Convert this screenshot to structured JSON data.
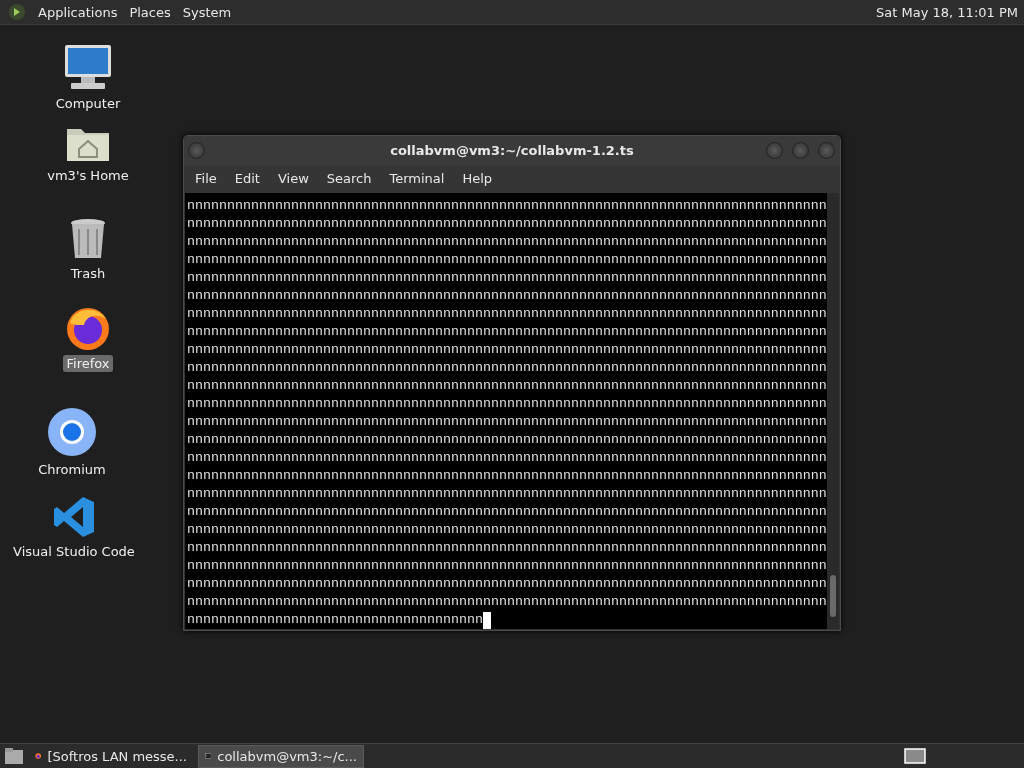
{
  "top_panel": {
    "menus": [
      "Applications",
      "Places",
      "System"
    ],
    "clock": "Sat May 18, 11:01 PM"
  },
  "desktop_icons": [
    {
      "label": "Computer",
      "kind": "computer",
      "selected": false
    },
    {
      "label": "vm3's Home",
      "kind": "home",
      "selected": false
    },
    {
      "label": "Trash",
      "kind": "trash",
      "selected": false
    },
    {
      "label": "Firefox",
      "kind": "firefox",
      "selected": true
    },
    {
      "label": "Chromium",
      "kind": "chromium",
      "selected": false
    },
    {
      "label": "Visual Studio Code",
      "kind": "vscode",
      "selected": false
    }
  ],
  "terminal_window": {
    "title": "collabvm@vm3:~/collabvm-1.2.ts",
    "menus": [
      "File",
      "Edit",
      "View",
      "Search",
      "Terminal",
      "Help"
    ],
    "lines": [
      "nnnnnnnnnnnnnnnnnnnnnnnnnnnnnnnnnnnnnnnnnnnnnnnnnnnnnnnnnnnnnnnnnnnnnnnnnnnnnnnn",
      "nnnnnnnnnnnnnnnnnnnnnnnnnnnnnnnnnnnnnnnnnnnnnnnnnnnnnnnnnnnnnnnnnnnnnnnnnnnnnnnn",
      "nnnnnnnnnnnnnnnnnnnnnnnnnnnnnnnnnnnnnnnnnnnnnnnnnnnnnnnnnnnnnnnnnnnnnnnnnnnnnnnn",
      "nnnnnnnnnnnnnnnnnnnnnnnnnnnnnnnnnnnnnnnnnnnnnnnnnnnnnnnnnnnnnnnnnnnnnnnnnnnnnnnn",
      "nnnnnnnnnnnnnnnnnnnnnnnnnnnnnnnnnnnnnnnnnnnnnnnnnnnnnnnnnnnnnnnnnnnnnnnnnnnnnnnn",
      "nnnnnnnnnnnnnnnnnnnnnnnnnnnnnnnnnnnnnnnnnnnnnnnnnnnnnnnnnnnnnnnnnnnnnnnnnnnnnnnn",
      "nnnnnnnnnnnnnnnnnnnnnnnnnnnnnnnnnnnnnnnnnnnnnnnnnnnnnnnnnnnnnnnnnnnnnnnnnnnnnnnn",
      "nnnnnnnnnnnnnnnnnnnnnnnnnnnnnnnnnnnnnnnnnnnnnnnnnnnnnnnnnnnnnnnnnnnnnnnnnnnnnnnn",
      "nnnnnnnnnnnnnnnnnnnnnnnnnnnnnnnnnnnnnnnnnnnnnnnnnnnnnnnnnnnnnnnnnnnnnnnnnnnnnnnn",
      "nnnnnnnnnnnnnnnnnnnnnnnnnnnnnnnnnnnnnnnnnnnnnnnnnnnnnnnnnnnnnnnnnnnnnnnnnnnnnnnn",
      "nnnnnnnnnnnnnnnnnnnnnnnnnnnnnnnnnnnnnnnnnnnnnnnnnnnnnnnnnnnnnnnnnnnnnnnnnnnnnnnn",
      "nnnnnnnnnnnnnnnnnnnnnnnnnnnnnnnnnnnnnnnnnnnnnnnnnnnnnnnnnnnnnnnnnnnnnnnnnnnnnnnn",
      "nnnnnnnnnnnnnnnnnnnnnnnnnnnnnnnnnnnnnnnnnnnnnnnnnnnnnnnnnnnnnnnnnnnnnnnnnnnnnnnn",
      "nnnnnnnnnnnnnnnnnnnnnnnnnnnnnnnnnnnnnnnnnnnnnnnnnnnnnnnnnnnnnnnnnnnnnnnnnnnnnnnn",
      "nnnnnnnnnnnnnnnnnnnnnnnnnnnnnnnnnnnnnnnnnnnnnnnnnnnnnnnnnnnnnnnnnnnnnnnnnnnnnnnn",
      "nnnnnnnnnnnnnnnnnnnnnnnnnnnnnnnnnnnnnnnnnnnnnnnnnnnnnnnnnnnnnnnnnnnnnnnnnnnnnnnn",
      "nnnnnnnnnnnnnnnnnnnnnnnnnnnnnnnnnnnnnnnnnnnnnnnnnnnnnnnnnnnnnnnnnnnnnnnnnnnnnnnn",
      "nnnnnnnnnnnnnnnnnnnnnnnnnnnnnnnnnnnnnnnnnnnnnnnnnnnnnnnnnnnnnnnnnnnnnnnnnnnnnnnn",
      "nnnnnnnnnnnnnnnnnnnnnnnnnnnnnnnnnnnnnnnnnnnnnnnnnnnnnnnnnnnnnnnnnnnnnnnnnnnnnnnn",
      "nnnnnnnnnnnnnnnnnnnnnnnnnnnnnnnnnnnnnnnnnnnnnnnnnnnnnnnnnnnnnnnnnnnnnnnnnnnnnnnn",
      "nnnnnnnnnnnnnnnnnnnnnnnnnnnnnnnnnnnnnnnnnnnnnnnnnnnnnnnnnnnnnnnnnnnnnnnnnnnnnnnn",
      "nnnnnnnnnnnnnnnnnnnnnnnnnnnnnnnnnnnnnnnnnnnnnnnnnnnnnnnnnnnnnnnnnnnnnnnnnnnnnnnn",
      "nnnnnnnnnnnnnnnnnnnnnnnnnnnnnnnnnnnnnnnnnnnnnnnnnnnnnnnnnnnnnnnnnnnnnnnnnnnnnnnn",
      "nnnnnnnnnnnnnnnnnnnnnnnnnnnnnnnnnnnnn"
    ]
  },
  "taskbar": {
    "items": [
      {
        "label": "[Softros LAN messe...",
        "kind": "firefox",
        "selected": false
      },
      {
        "label": "collabvm@vm3:~/c...",
        "kind": "terminal",
        "selected": true
      }
    ]
  }
}
